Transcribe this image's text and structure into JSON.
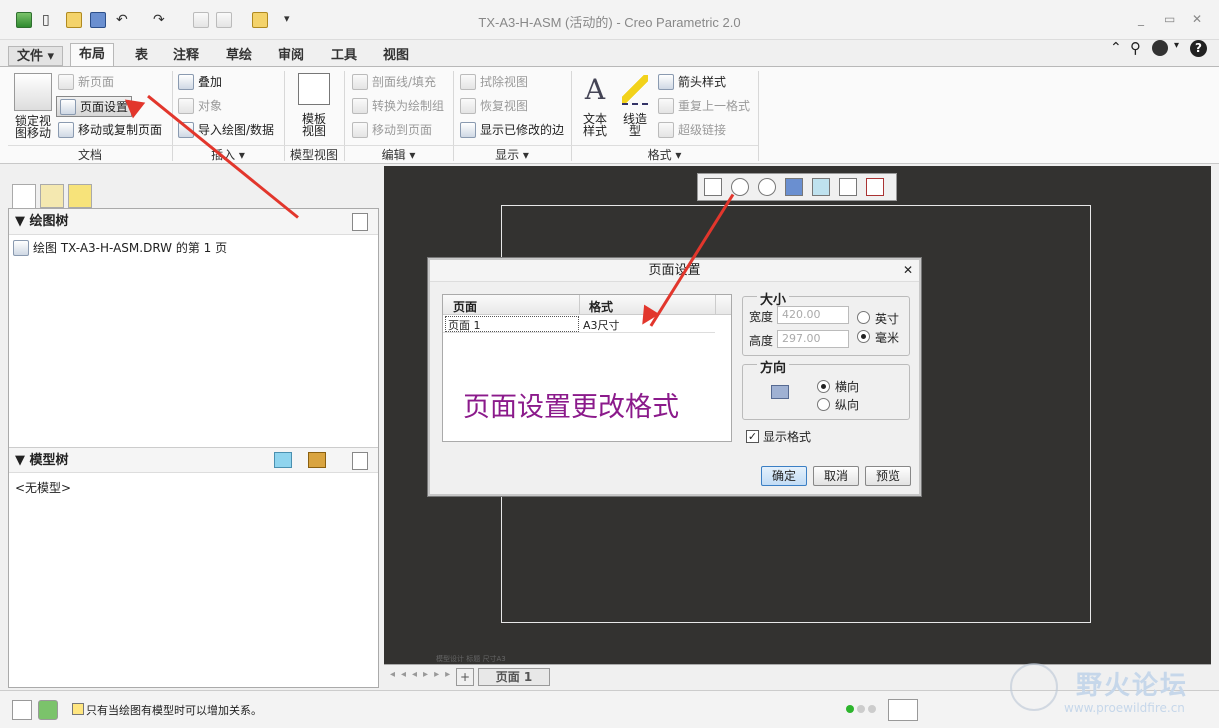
{
  "window": {
    "title": "TX-A3-H-ASM (活动的) - Creo Parametric 2.0",
    "min": "▭",
    "restore": "▭",
    "close": "✕"
  },
  "qat": {
    "new": "▯",
    "open": "📂",
    "save": "💾",
    "undo": "↶",
    "redo": "↷",
    "more": "▾"
  },
  "tabs": [
    "文件",
    "布局",
    "表",
    "注释",
    "草绘",
    "审阅",
    "工具",
    "视图"
  ],
  "ribbon": {
    "lock_view": "锁定视\n图移动",
    "new_page": "新页面",
    "page_setup": "页面设置",
    "move_copy": "移动或复制页面",
    "overlay": "叠加",
    "object": "对象",
    "import": "导入绘图/数据",
    "template_view": "模板\n视图",
    "section_line": "剖面线/填充",
    "convert": "转换为绘制组",
    "move_to_page": "移动到页面",
    "erase_view": "拭除视图",
    "restore_view": "恢复视图",
    "show_modified": "显示已修改的边",
    "text_style": "文本\n样式",
    "line_style": "线造\n型",
    "arrow_style": "箭头样式",
    "repeat_format": "重复上一格式",
    "hyperlink": "超级链接",
    "groups": [
      "文档",
      "插入 ▾",
      "模型视图",
      "编辑 ▾",
      "显示 ▾",
      "格式 ▾"
    ]
  },
  "left": {
    "drawing_tree_title": "绘图树",
    "drawing_item": "绘图 TX-A3-H-ASM.DRW 的第 1 页",
    "model_tree_title": "模型树",
    "no_model": "<无模型>"
  },
  "dialog": {
    "title": "页面设置",
    "close": "✕",
    "col_page": "页面",
    "col_format": "格式",
    "row_page": "页面 1",
    "row_format": "A3尺寸",
    "annotation": "页面设置更改格式",
    "size_legend": "大小",
    "width_label": "宽度",
    "width_value": "420.00",
    "height_label": "高度",
    "height_value": "297.00",
    "unit_inch": "英寸",
    "unit_mm": "毫米",
    "orient_legend": "方向",
    "landscape": "横向",
    "portrait": "纵向",
    "show_format": "显示格式",
    "ok": "确定",
    "cancel": "取消",
    "preview": "预览"
  },
  "canvas": {
    "faint_text": "模型设计  标题   尺寸A3"
  },
  "pagebar": {
    "add": "+",
    "page_tab": "页面 1"
  },
  "status": {
    "message": "只有当绘图有模型时可以增加关系。"
  },
  "watermark": {
    "logo_text": "野火论坛",
    "url": "www.proewildfire.cn"
  },
  "colors": {
    "canvas": "#333230",
    "arrow": "#e2362c",
    "annotation": "#8b1a8b"
  }
}
